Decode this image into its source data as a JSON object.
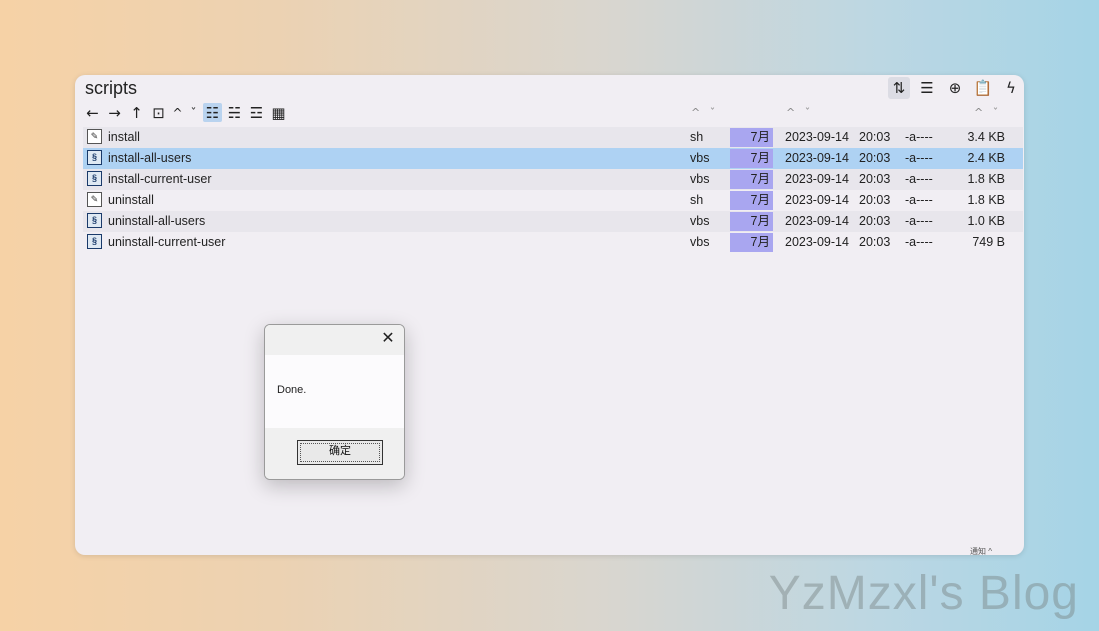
{
  "window": {
    "title": "scripts",
    "top_buttons": [
      {
        "icon": "sort-icon",
        "glyph": "⇅"
      },
      {
        "icon": "list-view-icon",
        "glyph": "☰"
      },
      {
        "icon": "add-circle-icon",
        "glyph": "⊕"
      },
      {
        "icon": "clipboard-icon",
        "glyph": "📋"
      },
      {
        "icon": "bolt-icon",
        "glyph": "ϟ"
      }
    ],
    "toolbar": {
      "back": "←",
      "forward": "→",
      "up": "↑",
      "folder": "⊡",
      "caret_up": "^",
      "caret_down": "ˇ",
      "view_details": "☷",
      "view_list": "☵",
      "view_tree": "☲",
      "view_grid": "▦"
    }
  },
  "files": [
    {
      "name": "install",
      "type": "sh",
      "month": "7月",
      "date": "2023-09-14",
      "time": "20:03",
      "attr": "-a----",
      "size": "3.4 KB",
      "kind": "sh"
    },
    {
      "name": "install-all-users",
      "type": "vbs",
      "month": "7月",
      "date": "2023-09-14",
      "time": "20:03",
      "attr": "-a----",
      "size": "2.4 KB",
      "kind": "vbs"
    },
    {
      "name": "install-current-user",
      "type": "vbs",
      "month": "7月",
      "date": "2023-09-14",
      "time": "20:03",
      "attr": "-a----",
      "size": "1.8 KB",
      "kind": "vbs"
    },
    {
      "name": "uninstall",
      "type": "sh",
      "month": "7月",
      "date": "2023-09-14",
      "time": "20:03",
      "attr": "-a----",
      "size": "1.8 KB",
      "kind": "sh"
    },
    {
      "name": "uninstall-all-users",
      "type": "vbs",
      "month": "7月",
      "date": "2023-09-14",
      "time": "20:03",
      "attr": "-a----",
      "size": "1.0 KB",
      "kind": "vbs"
    },
    {
      "name": "uninstall-current-user",
      "type": "vbs",
      "month": "7月",
      "date": "2023-09-14",
      "time": "20:03",
      "attr": "-a----",
      "size": "749 B",
      "kind": "vbs"
    }
  ],
  "selected_index": 1,
  "dialog": {
    "close_glyph": "✕",
    "message": "Done.",
    "ok_label": "确定"
  },
  "status": {
    "label": "通知 ^"
  },
  "watermark": "YzMzxl's Blog"
}
